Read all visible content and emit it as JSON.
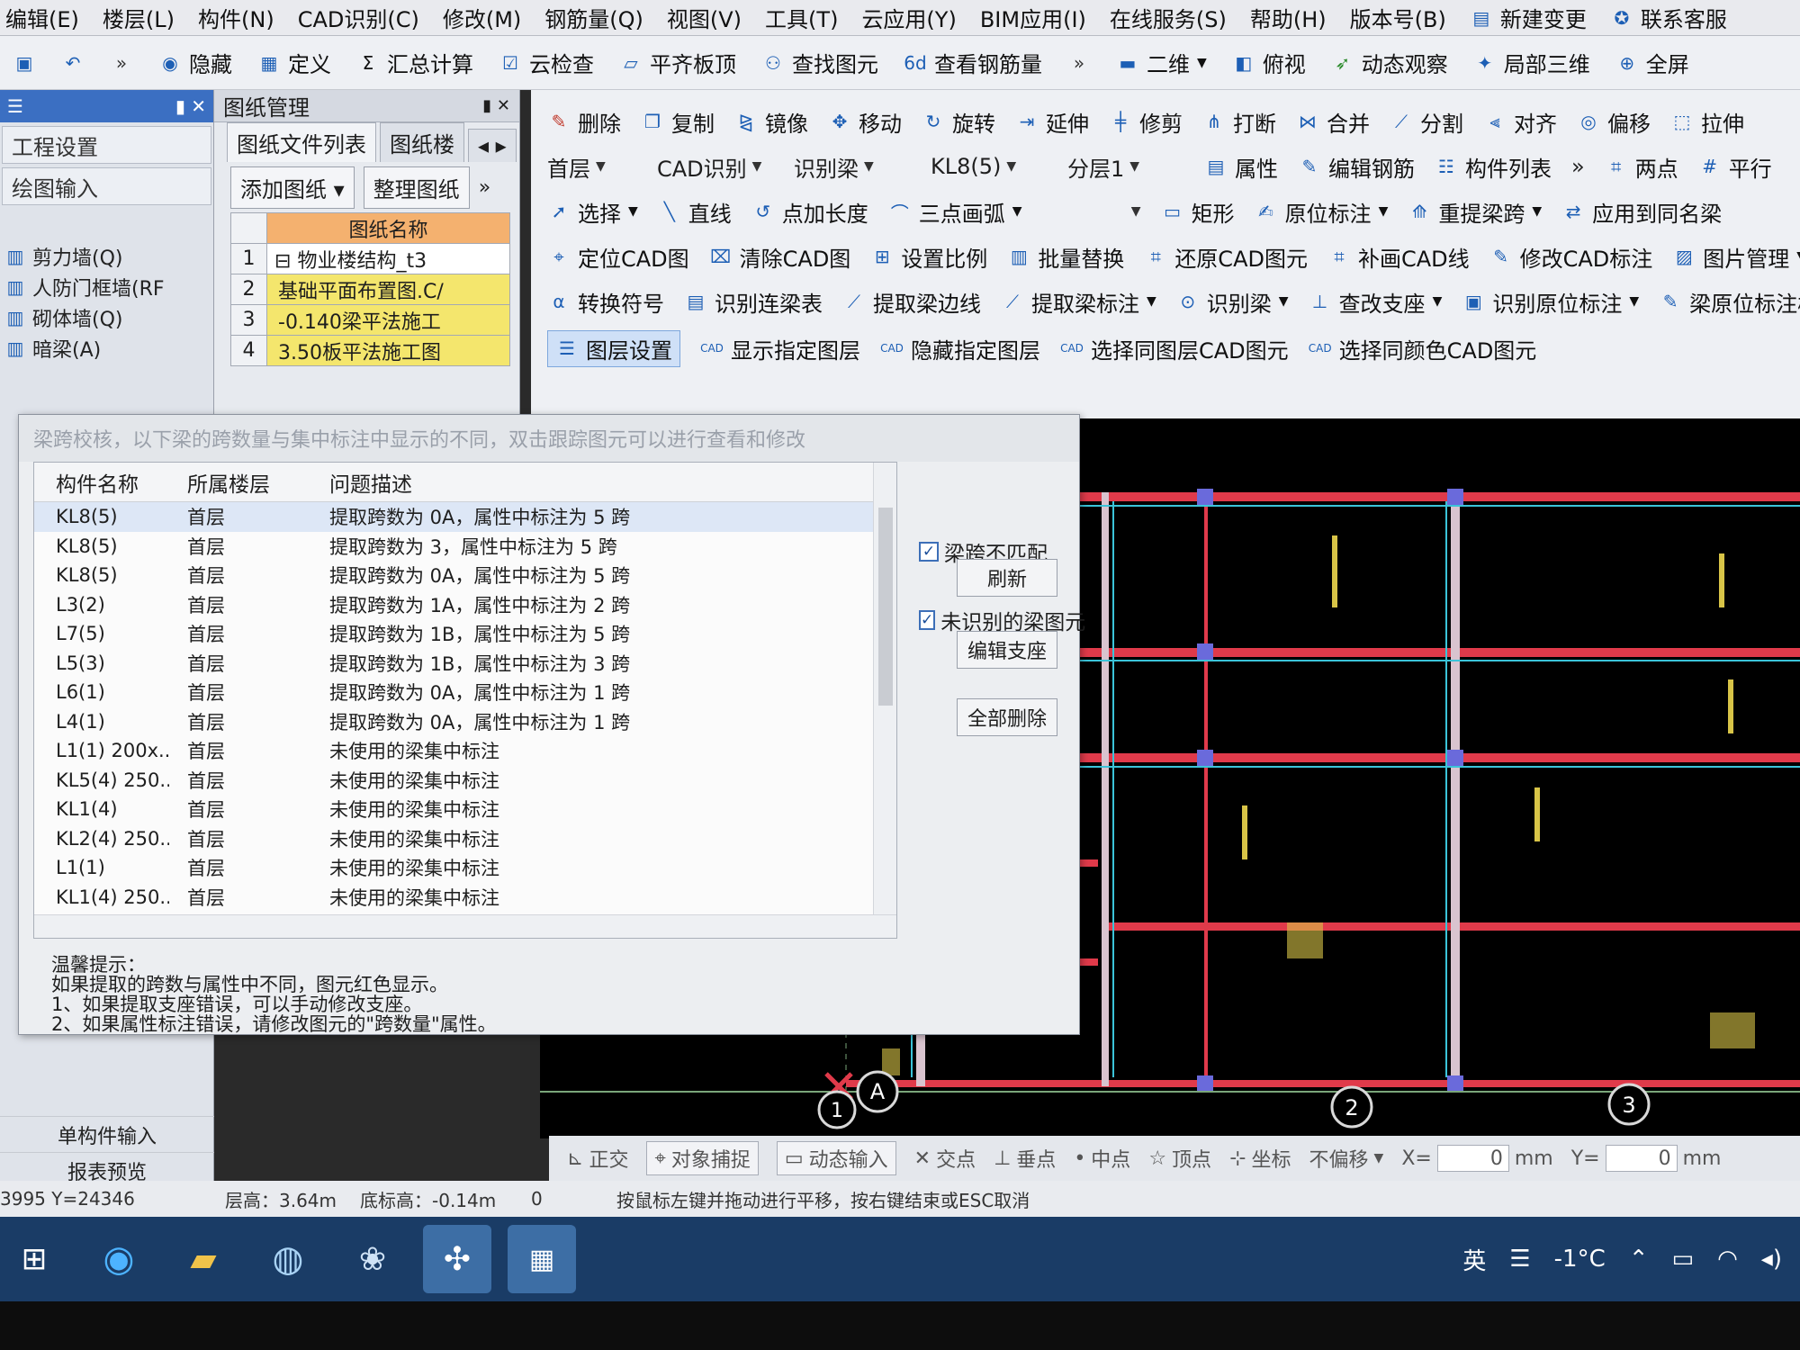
{
  "menubar": {
    "items": [
      "编辑(E)",
      "楼层(L)",
      "构件(N)",
      "CAD识别(C)",
      "修改(M)",
      "钢筋量(Q)",
      "视图(V)",
      "工具(T)",
      "云应用(Y)",
      "BIM应用(I)",
      "在线服务(S)",
      "帮助(H)",
      "版本号(B)"
    ],
    "new_change": "新建变更",
    "support": "联系客服"
  },
  "quicktool": {
    "items": [
      "隐藏",
      "定义",
      "汇总计算",
      "云检查",
      "平齐板顶",
      "查找图元",
      "查看钢筋量"
    ],
    "view_mode": "二维",
    "items_right": [
      "俯视",
      "动态观察",
      "局部三维",
      "全屏"
    ]
  },
  "leftnav": {
    "project_settings": "工程设置",
    "drawing_input": "绘图输入",
    "tree": [
      "剪力墙(Q)",
      "人防门框墙(RF",
      "砌体墙(Q)",
      "暗梁(A)"
    ],
    "single_input": "单构件输入",
    "report_preview": "报表预览"
  },
  "drawmgr": {
    "title": "图纸管理",
    "tab_files": "图纸文件列表",
    "tab_other": "图纸楼",
    "add_btn": "添加图纸",
    "sort_btn": "整理图纸",
    "col_name": "图纸名称",
    "rows": [
      {
        "n": "1",
        "name": "物业楼结构_t3"
      },
      {
        "n": "2",
        "name": "基础平面布置图.C/"
      },
      {
        "n": "3",
        "name": "-0.140梁平法施工"
      },
      {
        "n": "4",
        "name": "3.50板平法施工图"
      }
    ]
  },
  "ribbon": {
    "row1": [
      "删除",
      "复制",
      "镜像",
      "移动",
      "旋转",
      "延伸",
      "修剪",
      "打断",
      "合并",
      "分割",
      "对齐",
      "偏移",
      "拉伸"
    ],
    "row2": {
      "floor": "首层",
      "cad_recog": "CAD识别",
      "recog_beam": "识别梁",
      "member": "KL8(5)",
      "layer": "分层1",
      "items": [
        "属性",
        "编辑钢筋",
        "构件列表",
        "两点",
        "平行"
      ]
    },
    "row3": [
      "选择",
      "直线",
      "点加长度",
      "三点画弧",
      "矩形",
      "原位标注",
      "重提梁跨",
      "应用到同名梁"
    ],
    "row4": [
      "定位CAD图",
      "清除CAD图",
      "设置比例",
      "批量替换",
      "还原CAD图元",
      "补画CAD线",
      "修改CAD标注",
      "图片管理"
    ],
    "row5": [
      "转换符号",
      "识别连梁表",
      "提取梁边线",
      "提取梁标注",
      "识别梁",
      "查改支座",
      "识别原位标注",
      "梁原位标注校核"
    ],
    "row6": [
      "图层设置",
      "显示指定图层",
      "隐藏指定图层",
      "选择同图层CAD图元",
      "选择同颜色CAD图元"
    ]
  },
  "dialog": {
    "title": "梁跨校核，以下梁的跨数量与集中标注中显示的不同，双击跟踪图元可以进行查看和修改",
    "col_name": "构件名称",
    "col_floor": "所属楼层",
    "col_desc": "问题描述",
    "rows": [
      {
        "name": "KL8(5)",
        "floor": "首层",
        "desc": "提取跨数为 0A，属性中标注为 5 跨"
      },
      {
        "name": "KL8(5)",
        "floor": "首层",
        "desc": "提取跨数为 3，属性中标注为 5 跨"
      },
      {
        "name": "KL8(5)",
        "floor": "首层",
        "desc": "提取跨数为 0A，属性中标注为 5 跨"
      },
      {
        "name": "L3(2)",
        "floor": "首层",
        "desc": "提取跨数为 1A，属性中标注为 2 跨"
      },
      {
        "name": "L7(5)",
        "floor": "首层",
        "desc": "提取跨数为 1B，属性中标注为 5 跨"
      },
      {
        "name": "L5(3)",
        "floor": "首层",
        "desc": "提取跨数为 1B，属性中标注为 3 跨"
      },
      {
        "name": "L6(1)",
        "floor": "首层",
        "desc": "提取跨数为 0A，属性中标注为 1 跨"
      },
      {
        "name": "L4(1)",
        "floor": "首层",
        "desc": "提取跨数为 0A，属性中标注为 1 跨"
      },
      {
        "name": "L1(1) 200x...",
        "floor": "首层",
        "desc": "未使用的梁集中标注"
      },
      {
        "name": "KL5(4) 250...",
        "floor": "首层",
        "desc": "未使用的梁集中标注"
      },
      {
        "name": "KL1(4)",
        "floor": "首层",
        "desc": "未使用的梁集中标注"
      },
      {
        "name": "KL2(4) 250...",
        "floor": "首层",
        "desc": "未使用的梁集中标注"
      },
      {
        "name": "L1(1)",
        "floor": "首层",
        "desc": "未使用的梁集中标注"
      },
      {
        "name": "KL1(4) 250...",
        "floor": "首层",
        "desc": "未使用的梁集中标注"
      }
    ],
    "opt_mismatch": "梁跨不匹配",
    "opt_unrecognized": "未识别的梁图元",
    "refresh": "刷新",
    "edit_support": "编辑支座",
    "delete_all": "全部删除",
    "tips": [
      "温馨提示：",
      "如果提取的跨数与属性中不同，图元红色显示。",
      "1、如果提取支座错误，可以手动修改支座。",
      "2、如果属性标注错误，请修改图元的\"跨数量\"属性。"
    ]
  },
  "cad": {
    "axis_labels": [
      "A",
      "1",
      "2",
      "3"
    ]
  },
  "snapbar": {
    "items": [
      "正交",
      "对象捕捉",
      "动态输入",
      "交点",
      "垂点",
      "中点",
      "顶点",
      "坐标",
      "不偏移"
    ],
    "x_label": "X=",
    "x_value": "0",
    "y_label": "Y=",
    "y_value": "0",
    "unit": "mm"
  },
  "status": {
    "coord": "3995 Y=24346",
    "floor_height": "层高：3.64m",
    "base_elev": "底标高：-0.14m",
    "zero": "0",
    "hint": "按鼠标左键并拖动进行平移，按右键结束或ESC取消"
  },
  "taskbar": {
    "ime": "英",
    "temp": "-1°C"
  }
}
